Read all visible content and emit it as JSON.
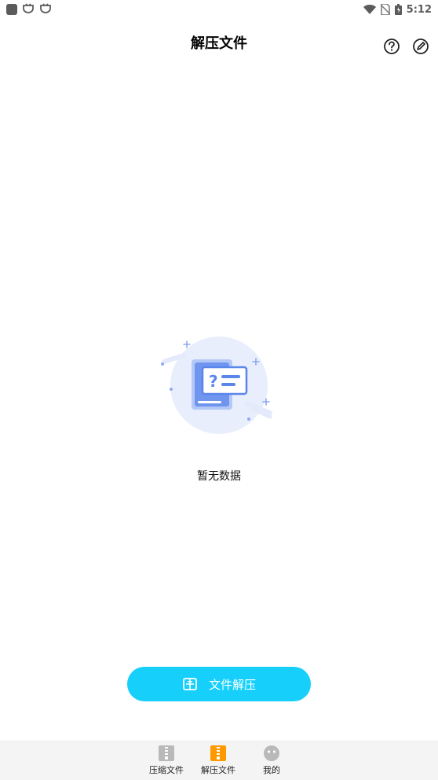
{
  "status_bar": {
    "time": "5:12",
    "left_icons": [
      "app-square-icon",
      "bug-icon",
      "bug-icon"
    ],
    "right_icons": [
      "wifi-icon",
      "no-sim-icon",
      "battery-icon"
    ]
  },
  "app_bar": {
    "title": "解压文件",
    "icons": [
      "help-icon",
      "edit-icon"
    ]
  },
  "empty_state": {
    "message": "暂无数据",
    "illustration": "empty-file-icon"
  },
  "primary_button": {
    "label": "文件解压",
    "icon": "extract-icon",
    "color": "#16d0fb"
  },
  "bottom_nav": {
    "items": [
      {
        "label": "压缩文件",
        "icon": "zip-file-icon",
        "active": false
      },
      {
        "label": "解压文件",
        "icon": "unzip-file-icon",
        "active": true
      },
      {
        "label": "我的",
        "icon": "profile-face-icon",
        "active": false
      }
    ],
    "active_color": "#ff9900"
  }
}
